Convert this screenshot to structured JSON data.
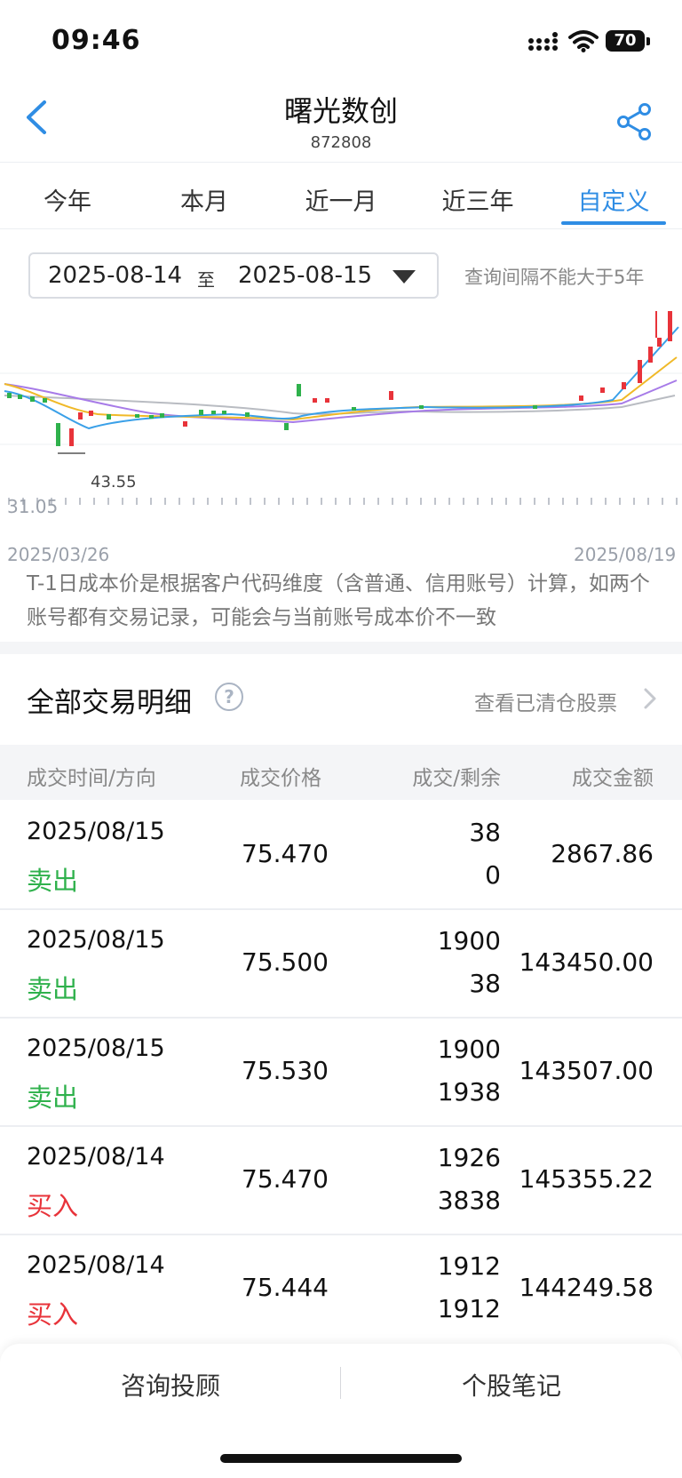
{
  "status_bar": {
    "time": "09:46",
    "battery": "70"
  },
  "header": {
    "title": "曙光数创",
    "code": "872808"
  },
  "tabs": [
    {
      "label": "今年"
    },
    {
      "label": "本月"
    },
    {
      "label": "近一月"
    },
    {
      "label": "近三年"
    },
    {
      "label": "自定义",
      "active": true
    }
  ],
  "date_range": {
    "start": "2025-08-14",
    "separator": "至",
    "end": "2025-08-15",
    "hint": "查询间隔不能大于5年"
  },
  "chart": {
    "min_label": "31.05",
    "marker_label": "43.55",
    "x_start": "2025/03/26",
    "x_end": "2025/08/19"
  },
  "note": "T-1日成本价是根据客户代码维度（含普通、信用账号）计算，如两个账号都有交易记录，可能会与当前账号成本价不一致",
  "section": {
    "title": "全部交易明细",
    "help": "?",
    "cleared_link": "查看已清仓股票"
  },
  "table": {
    "headers": [
      "成交时间/方向",
      "成交价格",
      "成交/剩余",
      "成交金额"
    ],
    "rows": [
      {
        "date": "2025/08/15",
        "direction": "卖出",
        "price": "75.470",
        "qty": "38",
        "remaining": "0",
        "amount": "2867.86"
      },
      {
        "date": "2025/08/15",
        "direction": "卖出",
        "price": "75.500",
        "qty": "1900",
        "remaining": "38",
        "amount": "143450.00"
      },
      {
        "date": "2025/08/15",
        "direction": "卖出",
        "price": "75.530",
        "qty": "1900",
        "remaining": "1938",
        "amount": "143507.00"
      },
      {
        "date": "2025/08/14",
        "direction": "买入",
        "price": "75.470",
        "qty": "1926",
        "remaining": "3838",
        "amount": "145355.22"
      },
      {
        "date": "2025/08/14",
        "direction": "买入",
        "price": "75.444",
        "qty": "1912",
        "remaining": "1912",
        "amount": "144249.58"
      }
    ]
  },
  "bottom_bar": {
    "consult": "咨询投顾",
    "notes": "个股笔记"
  },
  "colors": {
    "accent": "#2f8de4",
    "sell": "#2fb14c",
    "buy": "#e8333a"
  }
}
